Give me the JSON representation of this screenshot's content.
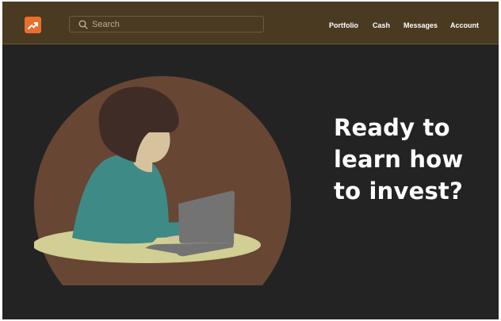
{
  "header": {
    "logo_icon": "trending-up-icon",
    "search": {
      "icon": "search-icon",
      "placeholder": "Search",
      "value": ""
    },
    "nav": [
      {
        "label": "Portfolio"
      },
      {
        "label": "Cash"
      },
      {
        "label": "Messages"
      },
      {
        "label": "Account"
      }
    ]
  },
  "hero": {
    "title_lines": [
      "Ready to",
      "learn how",
      "to invest?"
    ],
    "illustration": "person-using-laptop-illustration"
  },
  "colors": {
    "page_background": "#232323",
    "header_background": "#4a3a22",
    "accent": "#e8702a",
    "illustration_circle": "#674634",
    "table": "#d1cf93",
    "shirt": "#3d8a86",
    "laptop": "#737373"
  }
}
